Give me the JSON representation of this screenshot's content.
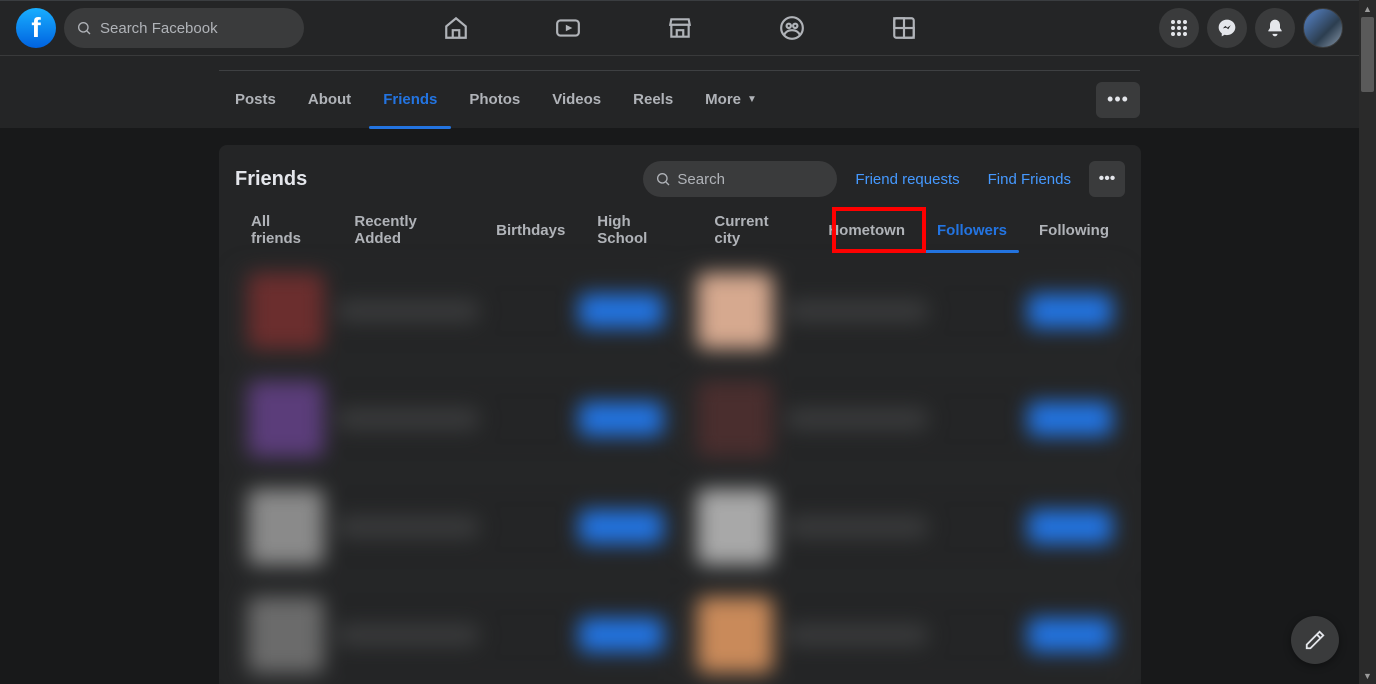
{
  "header": {
    "search_placeholder": "Search Facebook"
  },
  "profile_tabs": {
    "posts": "Posts",
    "about": "About",
    "friends": "Friends",
    "photos": "Photos",
    "videos": "Videos",
    "reels": "Reels",
    "more": "More"
  },
  "friends_panel": {
    "title": "Friends",
    "search_placeholder": "Search",
    "friend_requests": "Friend requests",
    "find_friends": "Find Friends"
  },
  "sub_tabs": {
    "all_friends": "All friends",
    "recently_added": "Recently Added",
    "birthdays": "Birthdays",
    "high_school": "High School",
    "current_city": "Current city",
    "hometown": "Hometown",
    "followers": "Followers",
    "following": "Following"
  },
  "highlight": {
    "target": "followers"
  },
  "colors": {
    "accent": "#2374e1",
    "link": "#4599ff",
    "bg": "#18191a",
    "surface": "#242526",
    "chip": "#3a3b3c",
    "text": "#e4e6eb",
    "muted": "#b0b3b8",
    "highlight_border": "#ff0000"
  }
}
